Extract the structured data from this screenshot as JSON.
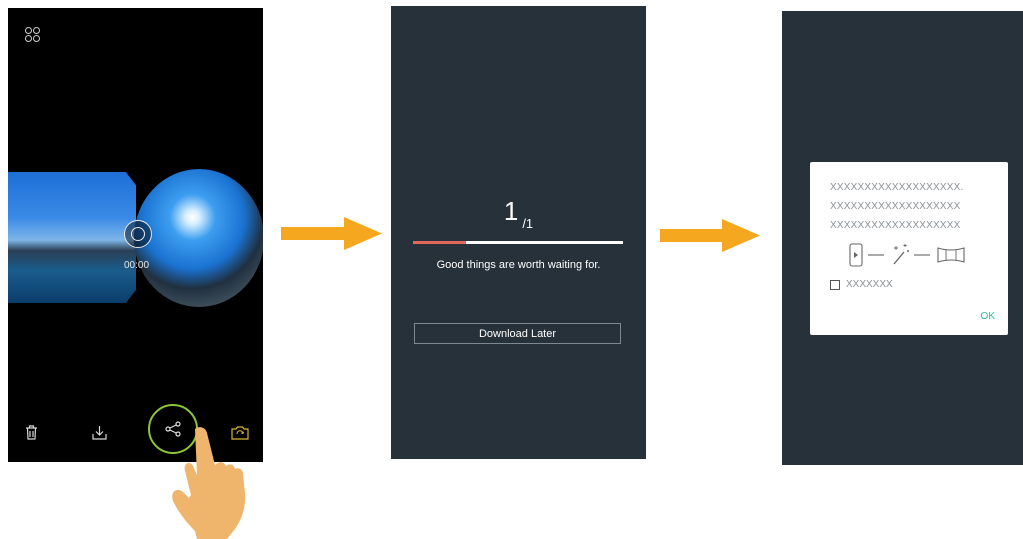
{
  "screen1": {
    "playback_time": "00:00",
    "icons": [
      "menu-icon",
      "trash-icon",
      "download-icon",
      "share-icon",
      "camera-switch-icon",
      "tap-hand-icon"
    ],
    "highlight_color": "#8cc43a"
  },
  "arrow_color": "#f5a81f",
  "screen2": {
    "counter_current": "1",
    "counter_total": "/1",
    "progress": 0.25,
    "progress_color": "#e4675f",
    "message": "Good things are worth waiting for.",
    "download_later_label": "Download Later"
  },
  "screen3": {
    "dialog_lines": [
      "XXXXXXXXXXXXXXXXXXX.",
      "XXXXXXXXXXXXXXXXXXX",
      "XXXXXXXXXXXXXXXXXXX"
    ],
    "checkbox_label": "XXXXXXX",
    "ok_label": "OK",
    "ok_color": "#2fb79c"
  },
  "background_color": "#27313a"
}
